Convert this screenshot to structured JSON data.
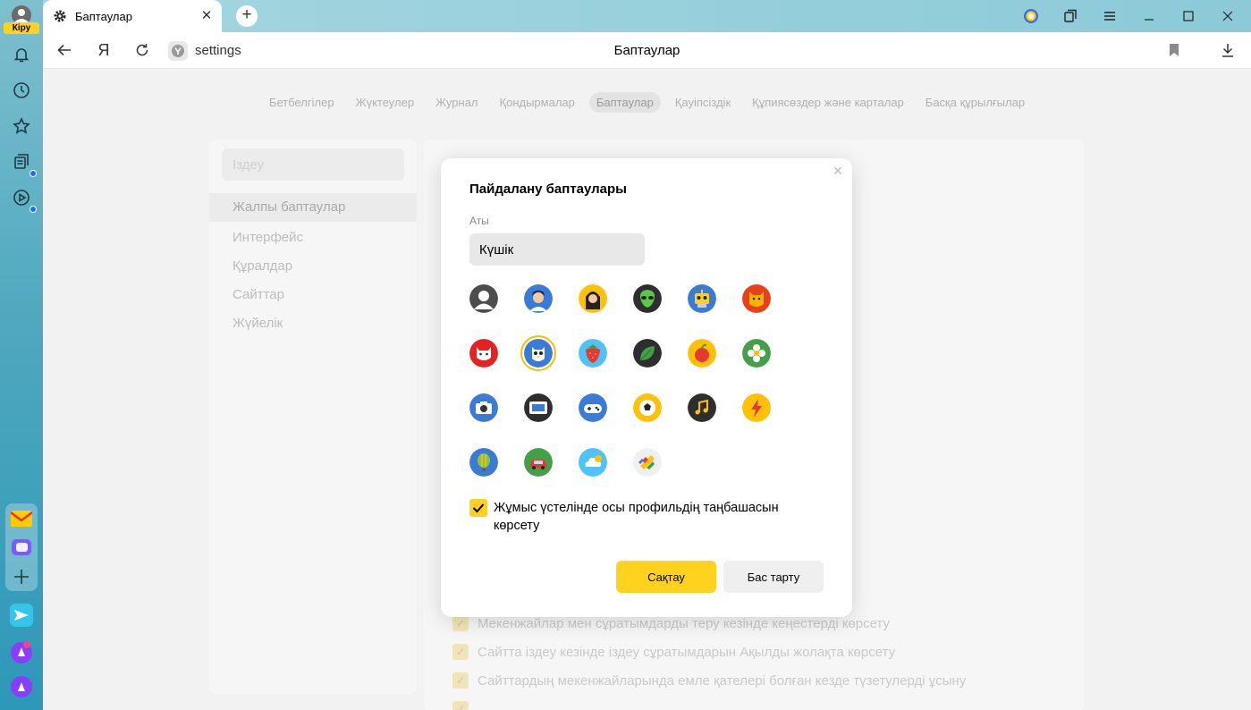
{
  "sidebar": {
    "login_label": "Кіру",
    "icons": [
      "notifications-icon",
      "history-icon",
      "favorites-icon",
      "collections-icon",
      "video-icon",
      "mail-icon",
      "messenger-icon",
      "add-icon",
      "send-icon",
      "alice-shopping-icon",
      "alice-icon"
    ]
  },
  "tab": {
    "title": "Баптаулар",
    "close": "✕"
  },
  "toolbar": {
    "back": "←",
    "ya": "Я",
    "url": "settings",
    "page_title": "Баптаулар"
  },
  "settings_nav": {
    "items": [
      "Бетбелгілер",
      "Жүктеулер",
      "Журнал",
      "Қондырмалар",
      "Баптаулар",
      "Қауіпсіздік",
      "Құпиясөздер және карталар",
      "Басқа құрылғылар"
    ],
    "active": "Баптаулар"
  },
  "left_menu": {
    "search_placeholder": "Іздеу",
    "items": [
      "Жалпы баптаулар",
      "Интерфейс",
      "Құралдар",
      "Сайттар",
      "Жүйелік"
    ]
  },
  "background_options": [
    "Мекенжайлар мен сұратымдарды теру кезінде кеңестерді көрсету",
    "Сайтта іздеу кезінде іздеу сұратымдарын Ақылды жолақта көрсету",
    "Сайттардың мекенжайларында емле қателері болған кезде түзетулерді ұсыну"
  ],
  "dialog": {
    "title": "Пайдалану баптаулары",
    "name_label": "Аты",
    "name_value": "Күшік",
    "avatars": [
      "person",
      "man",
      "woman",
      "alien",
      "robot",
      "fox",
      "cat",
      "owl",
      "strawberry",
      "leaf",
      "apple",
      "flower",
      "camera",
      "tv",
      "gamepad",
      "football",
      "music",
      "lightning",
      "balloon",
      "car",
      "cloud",
      "colorful"
    ],
    "selected_avatar": "owl",
    "desktop_shortcut_label": "Жұмыс үстелінде осы профильдің таңбашасын көрсету",
    "desktop_shortcut_checked": true,
    "save_label": "Сақтау",
    "cancel_label": "Бас тарту"
  },
  "colors": {
    "accent": "#ffd21f",
    "sidebar_top": "#7fc0cf",
    "sidebar_bottom": "#2e98b8"
  }
}
